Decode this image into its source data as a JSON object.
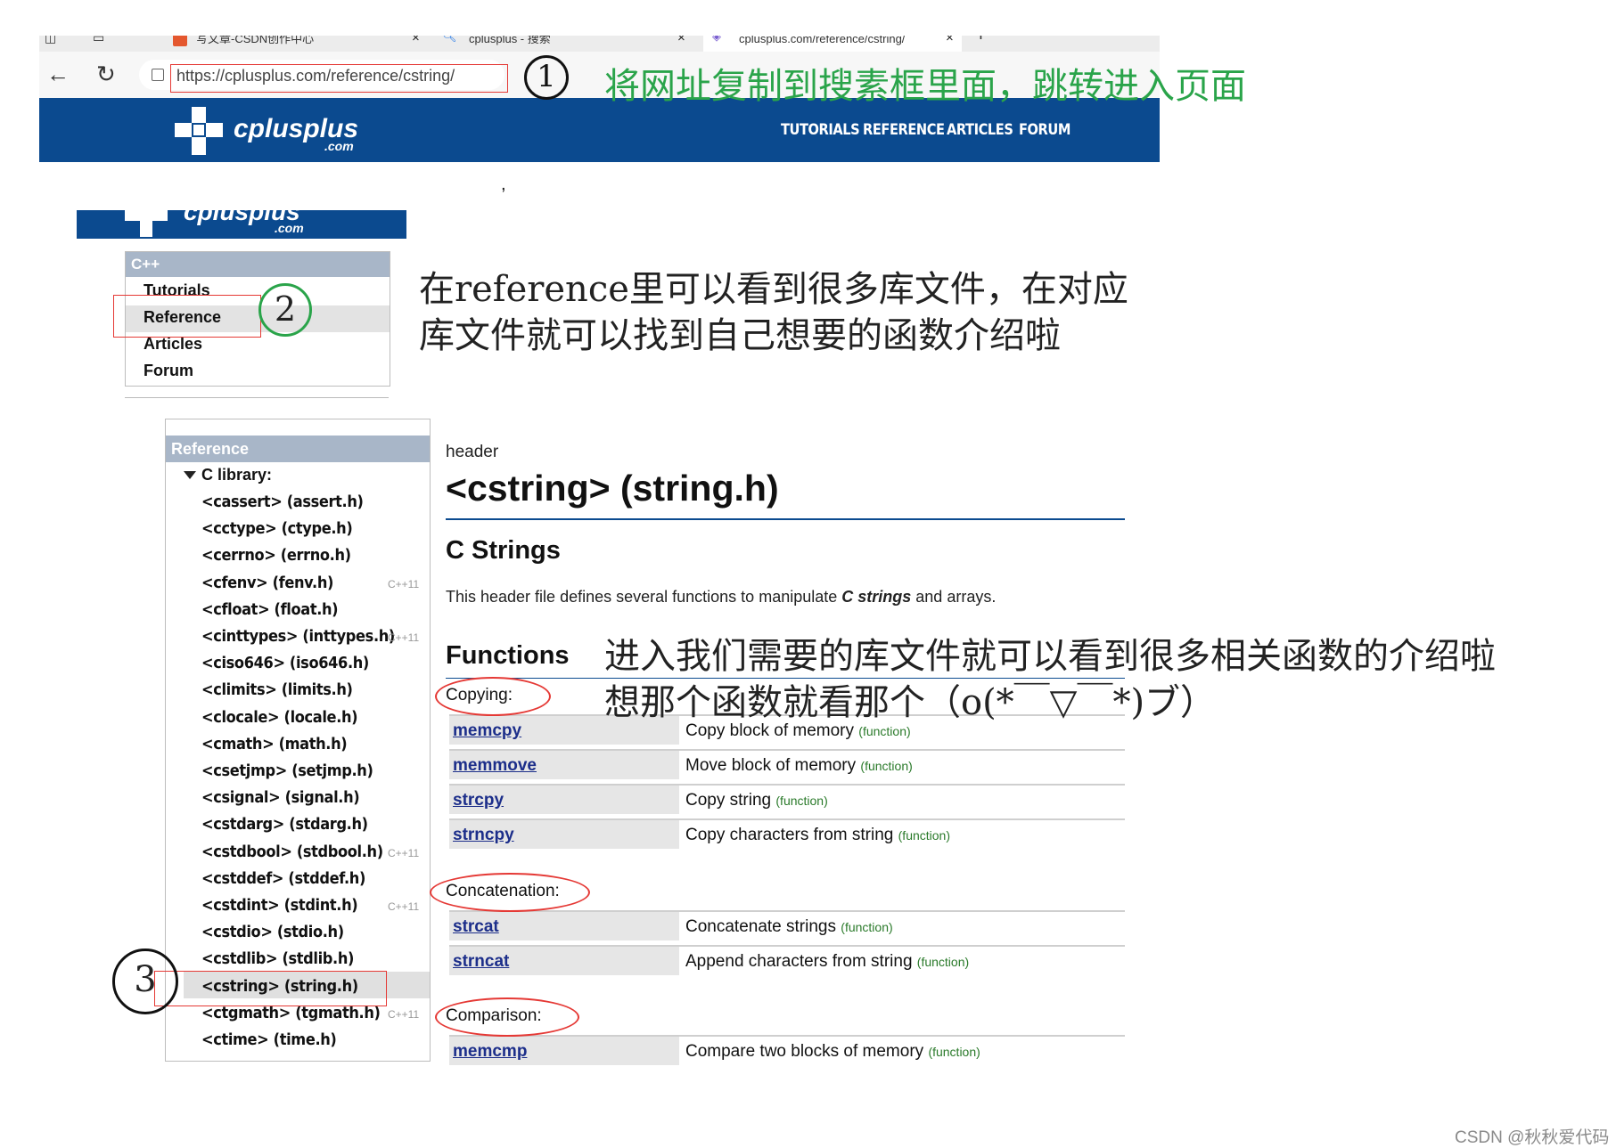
{
  "browser": {
    "tabs": [
      {
        "label": "写文章-CSDN创作中心"
      },
      {
        "label": "cplusplus - 搜索"
      },
      {
        "label": "cplusplus.com/reference/cstring/"
      }
    ],
    "new_tab": "+",
    "tab_close": "×",
    "url": "https://cplusplus.com/reference/cstring/"
  },
  "site": {
    "logo_word": "cplusplus",
    "logo_sub": ".com",
    "nav": [
      "TUTORIALS",
      "REFERENCE",
      "ARTICLES",
      "FORUM"
    ]
  },
  "cpp_menu": {
    "heading": "C++",
    "items": [
      "Tutorials",
      "Reference",
      "Articles",
      "Forum"
    ]
  },
  "reference_sidebar": {
    "heading": "Reference",
    "group": "C library:",
    "items": [
      {
        "label": "<cassert> (assert.h)",
        "badge": ""
      },
      {
        "label": "<cctype> (ctype.h)",
        "badge": ""
      },
      {
        "label": "<cerrno> (errno.h)",
        "badge": ""
      },
      {
        "label": "<cfenv> (fenv.h)",
        "badge": "C++11"
      },
      {
        "label": "<cfloat> (float.h)",
        "badge": ""
      },
      {
        "label": "<cinttypes> (inttypes.h)",
        "badge": "C++11"
      },
      {
        "label": "<ciso646> (iso646.h)",
        "badge": ""
      },
      {
        "label": "<climits> (limits.h)",
        "badge": ""
      },
      {
        "label": "<clocale> (locale.h)",
        "badge": ""
      },
      {
        "label": "<cmath> (math.h)",
        "badge": ""
      },
      {
        "label": "<csetjmp> (setjmp.h)",
        "badge": ""
      },
      {
        "label": "<csignal> (signal.h)",
        "badge": ""
      },
      {
        "label": "<cstdarg> (stdarg.h)",
        "badge": ""
      },
      {
        "label": "<cstdbool> (stdbool.h)",
        "badge": "C++11"
      },
      {
        "label": "<cstddef> (stddef.h)",
        "badge": ""
      },
      {
        "label": "<cstdint> (stdint.h)",
        "badge": "C++11"
      },
      {
        "label": "<cstdio> (stdio.h)",
        "badge": ""
      },
      {
        "label": "<cstdlib> (stdlib.h)",
        "badge": ""
      },
      {
        "label": "<cstring> (string.h)",
        "badge": ""
      },
      {
        "label": "<ctgmath> (tgmath.h)",
        "badge": "C++11"
      },
      {
        "label": "<ctime> (time.h)",
        "badge": ""
      }
    ]
  },
  "content": {
    "kind": "header",
    "title": "<cstring> (string.h)",
    "section": "C Strings",
    "desc_before": "This header file defines several functions to manipulate ",
    "desc_em": "C strings",
    "desc_after": " and arrays.",
    "functions_heading": "Functions",
    "groups": [
      {
        "label": "Copying:",
        "rows": [
          {
            "name": "memcpy",
            "desc": "Copy block of memory",
            "kind": "(function)"
          },
          {
            "name": "memmove",
            "desc": "Move block of memory",
            "kind": "(function)"
          },
          {
            "name": "strcpy",
            "desc": "Copy string",
            "kind": "(function)"
          },
          {
            "name": "strncpy",
            "desc": "Copy characters from string",
            "kind": "(function)"
          }
        ]
      },
      {
        "label": "Concatenation:",
        "rows": [
          {
            "name": "strcat",
            "desc": "Concatenate strings",
            "kind": "(function)"
          },
          {
            "name": "strncat",
            "desc": "Append characters from string",
            "kind": "(function)"
          }
        ]
      },
      {
        "label": "Comparison:",
        "rows": [
          {
            "name": "memcmp",
            "desc": "Compare two blocks of memory",
            "kind": "(function)"
          }
        ]
      }
    ]
  },
  "annotations": {
    "step1_num": "1",
    "step1_text": "将网址复制到搜素框里面，跳转进入页面",
    "step2_num": "2",
    "step2_line1": "在reference里可以看到很多库文件，在对应",
    "step2_line2": "库文件就可以找到自己想要的函数介绍啦",
    "step3_num": "3",
    "step3_line1": "进入我们需要的库文件就可以看到很多相关函数的介绍啦",
    "step3_line2": "想那个函数就看那个（o(*￣▽￣*)ブ）",
    "colors": {
      "green": "#2aa44a",
      "red": "#e53935",
      "brand_blue": "#0b4a8f"
    }
  },
  "watermark": "CSDN @秋秋爱代码"
}
